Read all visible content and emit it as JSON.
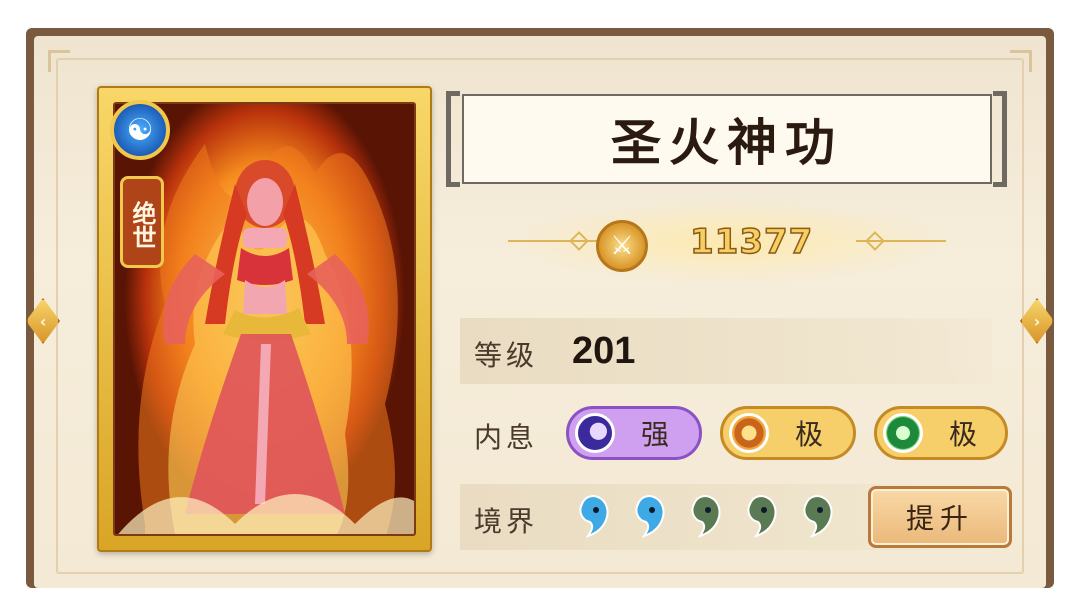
{
  "card": {
    "rank_tag": "绝世",
    "badge_icon": "yin-yang-icon"
  },
  "skill": {
    "title": "圣火神功",
    "power_icon": "sword-icon",
    "power_value": "11377"
  },
  "stats": {
    "level_label": "等级",
    "level_value": "201",
    "neixi_label": "内息",
    "neixi": [
      {
        "icon": "moon-orb-icon",
        "grade": "强",
        "color": "#cf9ff0"
      },
      {
        "icon": "sun-orb-icon",
        "grade": "极",
        "color": "#f6cf6a"
      },
      {
        "icon": "jade-orb-icon",
        "grade": "极",
        "color": "#f6cf6a"
      }
    ],
    "jingjie_label": "境界",
    "jingjie_filled": 2,
    "jingjie_total": 5,
    "upgrade_label": "提升"
  },
  "colors": {
    "drop_filled": "#3fa9e6",
    "drop_empty": "#5a7a54"
  }
}
